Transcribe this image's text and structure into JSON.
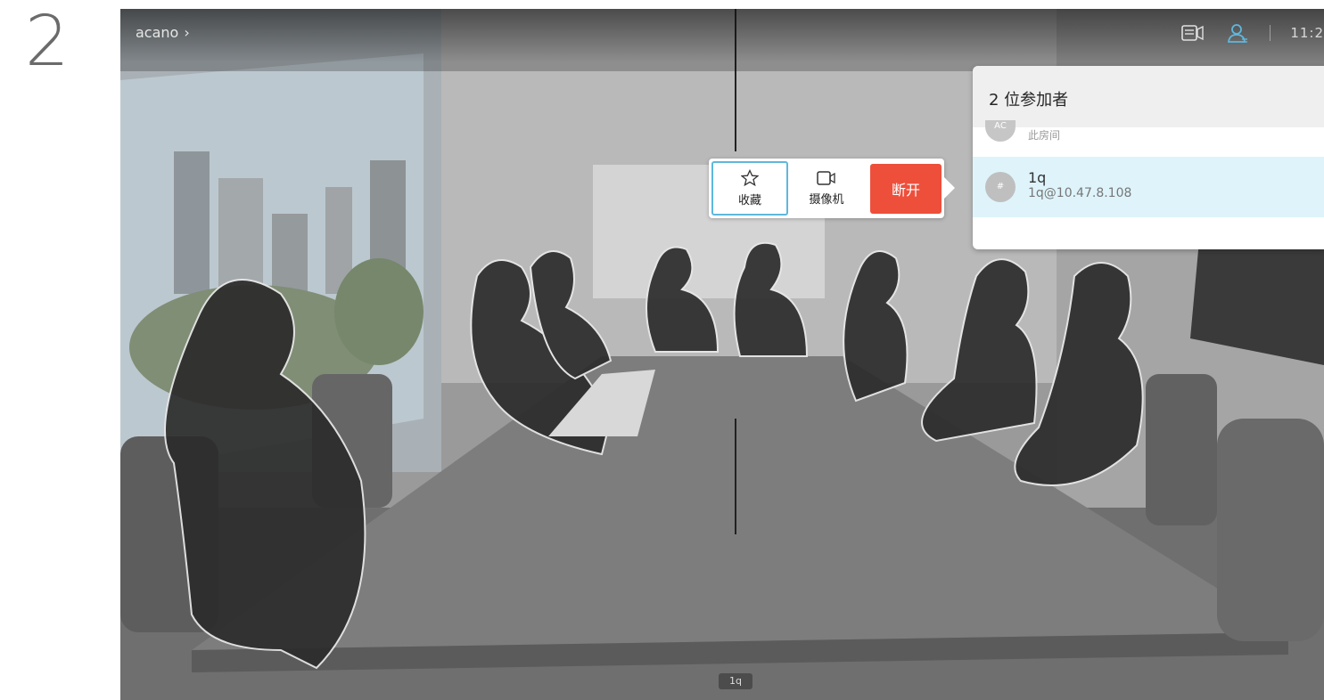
{
  "step_number": "2",
  "topbar": {
    "breadcrumb": "acano",
    "breadcrumb_chevron": "›",
    "icons": [
      "self-view-icon",
      "participants-icon"
    ],
    "time": "11:2"
  },
  "context_menu": {
    "favorite_label": "收藏",
    "favorite_icon": "star-icon",
    "camera_label": "摄像机",
    "camera_icon": "camera-icon",
    "disconnect_label": "断开"
  },
  "participants_panel": {
    "title": "2 位参加者",
    "participants": [
      {
        "avatar_text": "AC",
        "subtitle": "此房间"
      },
      {
        "avatar_text": "#",
        "name": "1q",
        "address": "1q@10.47.8.108"
      }
    ]
  },
  "video_name_tag": "1q",
  "colors": {
    "accent": "#5fb7dc",
    "danger": "#ee4f3b",
    "selected_row": "#def4fa"
  }
}
